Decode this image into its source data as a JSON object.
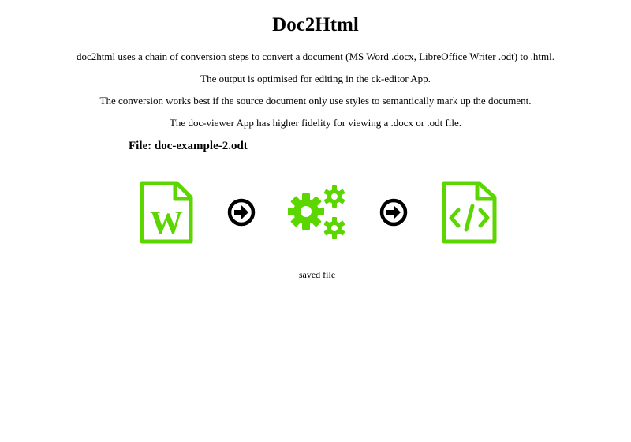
{
  "header": {
    "title": "Doc2Html"
  },
  "description": {
    "lines": [
      "doc2html uses a chain of conversion steps to convert a document (MS Word .docx, LibreOffice Writer .odt) to .html.",
      "The output is optimised for editing in the ck-editor App.",
      "The conversion works best if the source document only use styles to semantically mark up the document.",
      "The doc-viewer App has higher fidelity for viewing a .docx or .odt file."
    ]
  },
  "file": {
    "label": "File:",
    "name": "doc-example-2.odt"
  },
  "pipeline": {
    "accent_color": "#5cd600",
    "arrow_color": "#000000",
    "source_icon_letter": "W",
    "steps": [
      {
        "icon": "word-document-icon"
      },
      {
        "icon": "arrow-right-circle-icon"
      },
      {
        "icon": "gears-icon"
      },
      {
        "icon": "arrow-right-circle-icon"
      },
      {
        "icon": "html-code-file-icon"
      }
    ]
  },
  "status": {
    "text": "saved file"
  }
}
